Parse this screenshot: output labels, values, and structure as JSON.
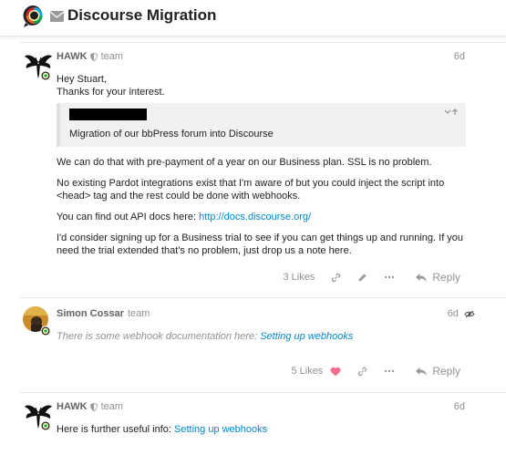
{
  "header": {
    "title": "Discourse Migration"
  },
  "posts": [
    {
      "username": "HAWK",
      "role": "team",
      "age": "6d",
      "greeting": "Hey Stuart,",
      "thanks": "Thanks for your interest.",
      "quote_text": "Migration of our bbPress forum into Discourse",
      "paragraphs": [
        "We can do that with pre-payment of a year on our Business plan. SSL is no problem.",
        "No existing Pardot integrations exist that I'm aware of but you could inject the script into <head> tag and the rest could be done with webhooks."
      ],
      "api_text": "You can find out API docs here: ",
      "api_link": "http://docs.discourse.org/",
      "closing": "I'd consider signing up for a Business trial to see if you can get things up and running. If you need the trial extended that's no problem, just drop us a note here.",
      "likes": "3 Likes",
      "reply": "Reply"
    },
    {
      "username": "Simon Cossar",
      "role": "team",
      "age": "6d",
      "body_prefix": "There is some webhook documentation here: ",
      "body_link": "Setting up webhooks",
      "likes": "5 Likes",
      "reply": "Reply"
    },
    {
      "username": "HAWK",
      "role": "team",
      "age": "6d",
      "body_prefix": "Here is further useful info: ",
      "body_link": "Setting up webhooks"
    }
  ],
  "icons": [
    "discourse-logo-icon",
    "envelope-icon",
    "shield-icon",
    "chevron-down-icon",
    "arrow-up-icon",
    "link-icon",
    "pencil-icon",
    "ellipsis-icon",
    "reply-icon",
    "heart-icon",
    "eye-slash-icon"
  ],
  "colors": {
    "accent": "#0088cc",
    "muted": "#919191",
    "heart": "#fa6c8d"
  }
}
